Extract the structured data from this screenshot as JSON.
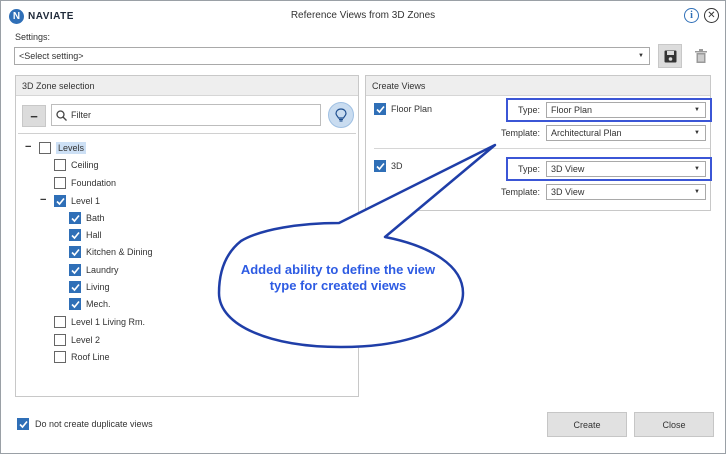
{
  "window": {
    "logo_text": "NAVIATE",
    "logo_mark": "N",
    "title": "Reference Views from 3D Zones",
    "icons": {
      "info": "info-icon",
      "close": "close-icon"
    }
  },
  "settings": {
    "label": "Settings:",
    "value": "<Select setting>"
  },
  "zone_panel": {
    "header": "3D Zone selection",
    "filter_placeholder": "Filter",
    "tree": [
      {
        "label": "Levels",
        "checked": false,
        "expanded": true,
        "selected": true
      },
      {
        "label": "Ceiling",
        "checked": false
      },
      {
        "label": "Foundation",
        "checked": false
      },
      {
        "label": "Level 1",
        "checked": true,
        "expanded": true
      },
      {
        "label": "Bath",
        "checked": true
      },
      {
        "label": "Hall",
        "checked": true
      },
      {
        "label": "Kitchen & Dining",
        "checked": true
      },
      {
        "label": "Laundry",
        "checked": true
      },
      {
        "label": "Living",
        "checked": true
      },
      {
        "label": "Mech.",
        "checked": true
      },
      {
        "label": "Level 1 Living Rm.",
        "checked": false
      },
      {
        "label": "Level 2",
        "checked": false
      },
      {
        "label": "Roof Line",
        "checked": false
      }
    ]
  },
  "views_panel": {
    "header": "Create Views",
    "floor_plan": {
      "label": "Floor Plan",
      "checked": true,
      "type_label": "Type:",
      "type_value": "Floor Plan",
      "template_label": "Template:",
      "template_value": "Architectural Plan"
    },
    "three_d": {
      "label": "3D",
      "checked": true,
      "type_label": "Type:",
      "type_value": "3D View",
      "template_label": "Template:",
      "template_value": "3D View"
    }
  },
  "callout": {
    "text": "Added ability to define the view type for created views"
  },
  "footer": {
    "duplicate_label": "Do not create duplicate views",
    "duplicate_checked": true,
    "create_label": "Create",
    "close_label": "Close"
  },
  "colors": {
    "accent": "#2f6fb7",
    "highlight": "#3b56d6",
    "callout_text": "#2d5be3"
  }
}
